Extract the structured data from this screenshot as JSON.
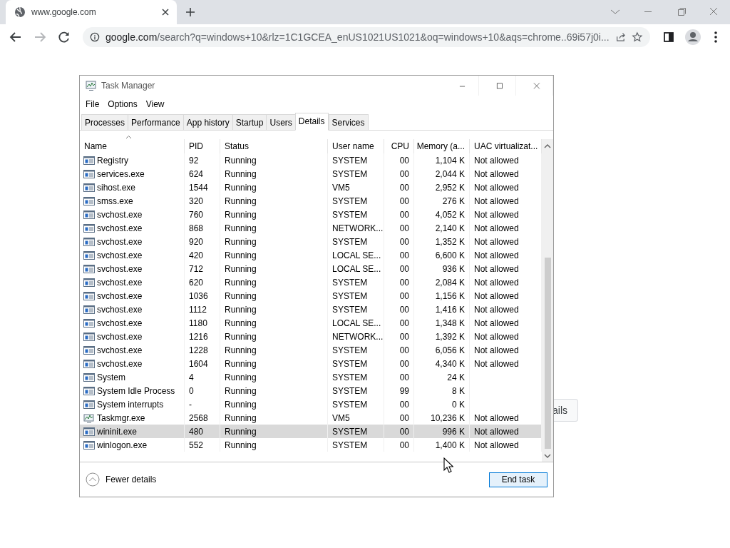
{
  "browser": {
    "tab_title": "www.google.com",
    "url": "google.com/search?q=windows+10&rlz=1C1GCEA_enUS1021US1021&oq=windows+10&aqs=chrome..69i57j0i..."
  },
  "page_button": {
    "label": "ails"
  },
  "window": {
    "title": "Task Manager"
  },
  "menu": [
    "File",
    "Options",
    "View"
  ],
  "tabs": [
    {
      "label": "Processes",
      "selected": false
    },
    {
      "label": "Performance",
      "selected": false
    },
    {
      "label": "App history",
      "selected": false
    },
    {
      "label": "Startup",
      "selected": false
    },
    {
      "label": "Users",
      "selected": false
    },
    {
      "label": "Details",
      "selected": true
    },
    {
      "label": "Services",
      "selected": false
    }
  ],
  "table": {
    "columns": [
      "Name",
      "PID",
      "Status",
      "User name",
      "CPU",
      "Memory (a...",
      "UAC virtualizat..."
    ],
    "rows": [
      {
        "kind": "process",
        "cells": [
          "Registry",
          "92",
          "Running",
          "SYSTEM",
          "00",
          "1,104 K",
          "Not allowed"
        ],
        "selected": false
      },
      {
        "kind": "process",
        "cells": [
          "services.exe",
          "624",
          "Running",
          "SYSTEM",
          "00",
          "2,044 K",
          "Not allowed"
        ],
        "selected": false
      },
      {
        "kind": "process",
        "cells": [
          "sihost.exe",
          "1544",
          "Running",
          "VM5",
          "00",
          "2,952 K",
          "Not allowed"
        ],
        "selected": false
      },
      {
        "kind": "process",
        "cells": [
          "smss.exe",
          "320",
          "Running",
          "SYSTEM",
          "00",
          "276 K",
          "Not allowed"
        ],
        "selected": false
      },
      {
        "kind": "process",
        "cells": [
          "svchost.exe",
          "760",
          "Running",
          "SYSTEM",
          "00",
          "4,052 K",
          "Not allowed"
        ],
        "selected": false
      },
      {
        "kind": "process",
        "cells": [
          "svchost.exe",
          "868",
          "Running",
          "NETWORK...",
          "00",
          "2,140 K",
          "Not allowed"
        ],
        "selected": false
      },
      {
        "kind": "process",
        "cells": [
          "svchost.exe",
          "920",
          "Running",
          "SYSTEM",
          "00",
          "1,352 K",
          "Not allowed"
        ],
        "selected": false
      },
      {
        "kind": "process",
        "cells": [
          "svchost.exe",
          "420",
          "Running",
          "LOCAL SE...",
          "00",
          "6,600 K",
          "Not allowed"
        ],
        "selected": false
      },
      {
        "kind": "process",
        "cells": [
          "svchost.exe",
          "712",
          "Running",
          "LOCAL SE...",
          "00",
          "936 K",
          "Not allowed"
        ],
        "selected": false
      },
      {
        "kind": "process",
        "cells": [
          "svchost.exe",
          "620",
          "Running",
          "SYSTEM",
          "00",
          "2,084 K",
          "Not allowed"
        ],
        "selected": false
      },
      {
        "kind": "process",
        "cells": [
          "svchost.exe",
          "1036",
          "Running",
          "SYSTEM",
          "00",
          "1,156 K",
          "Not allowed"
        ],
        "selected": false
      },
      {
        "kind": "process",
        "cells": [
          "svchost.exe",
          "1112",
          "Running",
          "SYSTEM",
          "00",
          "1,416 K",
          "Not allowed"
        ],
        "selected": false
      },
      {
        "kind": "process",
        "cells": [
          "svchost.exe",
          "1180",
          "Running",
          "LOCAL SE...",
          "00",
          "1,348 K",
          "Not allowed"
        ],
        "selected": false
      },
      {
        "kind": "process",
        "cells": [
          "svchost.exe",
          "1216",
          "Running",
          "NETWORK...",
          "00",
          "1,392 K",
          "Not allowed"
        ],
        "selected": false
      },
      {
        "kind": "process",
        "cells": [
          "svchost.exe",
          "1228",
          "Running",
          "SYSTEM",
          "00",
          "6,056 K",
          "Not allowed"
        ],
        "selected": false
      },
      {
        "kind": "process",
        "cells": [
          "svchost.exe",
          "1604",
          "Running",
          "SYSTEM",
          "00",
          "4,340 K",
          "Not allowed"
        ],
        "selected": false
      },
      {
        "kind": "process",
        "cells": [
          "System",
          "4",
          "Running",
          "SYSTEM",
          "00",
          "24 K"
        ],
        "selected": false
      },
      {
        "kind": "process",
        "cells": [
          "System Idle Process",
          "0",
          "Running",
          "SYSTEM",
          "99",
          "8 K"
        ],
        "selected": false
      },
      {
        "kind": "process",
        "cells": [
          "System interrupts",
          "-",
          "Running",
          "SYSTEM",
          "00",
          "0 K"
        ],
        "selected": false
      },
      {
        "kind": "monitor",
        "cells": [
          "Taskmgr.exe",
          "2568",
          "Running",
          "VM5",
          "00",
          "10,236 K",
          "Not allowed"
        ],
        "selected": false
      },
      {
        "kind": "process",
        "cells": [
          "wininit.exe",
          "480",
          "Running",
          "SYSTEM",
          "00",
          "996 K",
          "Not allowed"
        ],
        "selected": true
      },
      {
        "kind": "process",
        "cells": [
          "winlogon.exe",
          "552",
          "Running",
          "SYSTEM",
          "00",
          "1,400 K",
          "Not allowed"
        ],
        "selected": false
      }
    ]
  },
  "footer": {
    "toggle": "Fewer details",
    "button": "End task"
  }
}
